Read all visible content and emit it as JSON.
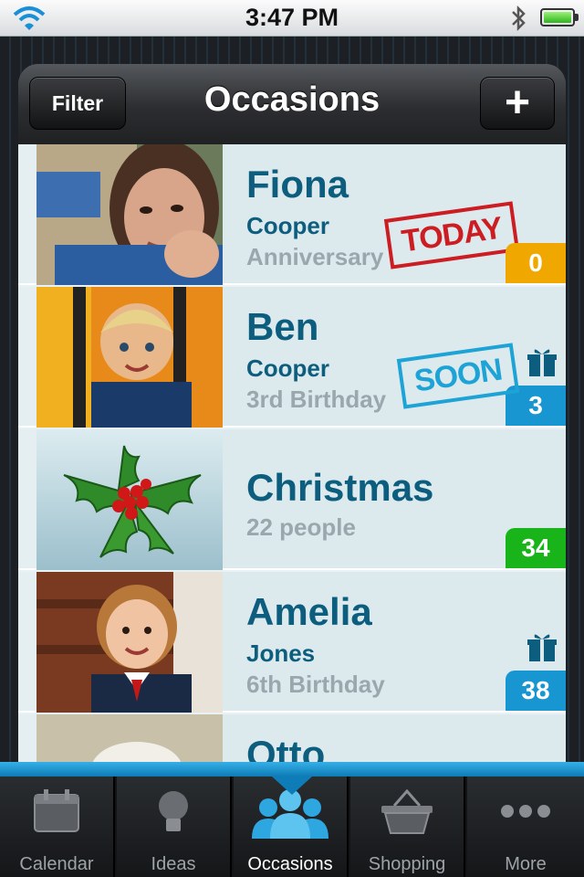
{
  "status": {
    "time": "3:47 PM"
  },
  "navbar": {
    "title": "Occasions",
    "filter_label": "Filter",
    "add_label": "+"
  },
  "rows": [
    {
      "name": "Fiona",
      "line1": "Cooper",
      "line2": "Anniversary",
      "stamp": "TODAY",
      "count": "0",
      "count_color": "#f0a800"
    },
    {
      "name": "Ben",
      "line1": "Cooper",
      "line2": "3rd Birthday",
      "stamp": "SOON",
      "count": "3",
      "count_color": "#1796d2"
    },
    {
      "name": "Christmas",
      "line1": "22 people",
      "count": "34",
      "count_color": "#19b419"
    },
    {
      "name": "Amelia",
      "line1": "Jones",
      "line2": "6th Birthday",
      "count": "38",
      "count_color": "#1796d2"
    },
    {
      "name": "Otto"
    }
  ],
  "tabs": [
    {
      "label": "Calendar",
      "icon": "calendar-icon"
    },
    {
      "label": "Ideas",
      "icon": "lightbulb-icon"
    },
    {
      "label": "Occasions",
      "icon": "people-icon",
      "active": true
    },
    {
      "label": "Shopping",
      "icon": "basket-icon"
    },
    {
      "label": "More",
      "icon": "more-icon"
    }
  ]
}
